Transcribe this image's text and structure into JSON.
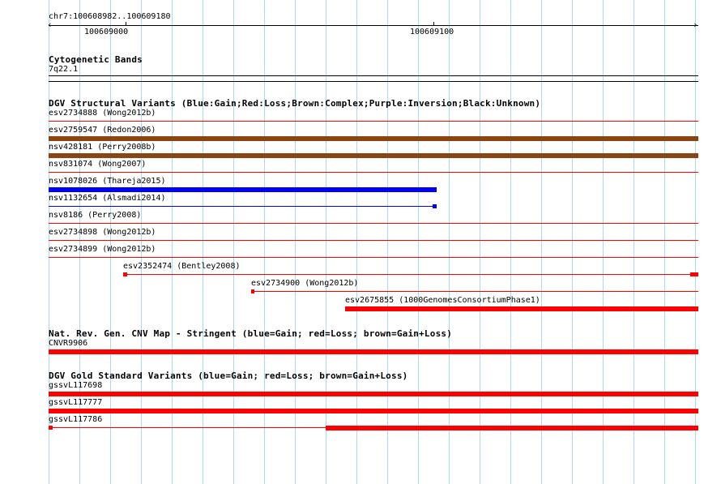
{
  "ruler": {
    "position": "chr7:100608982..100609180",
    "ticks": [
      "100609000",
      "100609100"
    ]
  },
  "cytoband": {
    "title": "Cytogenetic Bands",
    "band": "7q22.1"
  },
  "dgv": {
    "title": "DGV Structural Variants (Blue:Gain;Red:Loss;Brown:Complex;Purple:Inversion;Black:Unknown)",
    "features": [
      {
        "label": "esv2734888 (Wong2012b)",
        "color": "#ff0000",
        "style": "thin"
      },
      {
        "label": "esv2759547 (Redon2006)",
        "color": "#8b4513",
        "style": "thick"
      },
      {
        "label": "nsv428181 (Perry2008b)",
        "color": "#8b4513",
        "style": "thick"
      },
      {
        "label": "nsv831074 (Wong2007)",
        "color": "#ff0000",
        "style": "thin"
      },
      {
        "label": "nsv1078026 (Thareja2015)",
        "color": "#0000ff",
        "style": "thick"
      },
      {
        "label": "nsv1132654 (Alsmadi2014)",
        "color": "#0000ff",
        "style": "thin-cap"
      },
      {
        "label": "nsv8186 (Perry2008)",
        "color": "#ff0000",
        "style": "thin"
      },
      {
        "label": "esv2734898 (Wong2012b)",
        "color": "#ff0000",
        "style": "thin"
      },
      {
        "label": "esv2734899 (Wong2012b)",
        "color": "#ff0000",
        "style": "thin"
      },
      {
        "label": "esv2352474 (Bentley2008)",
        "color": "#ff0000",
        "style": "thin-cap"
      },
      {
        "label": "esv2734900 (Wong2012b)",
        "color": "#ff0000",
        "style": "thin-cap"
      },
      {
        "label": "esv2675855 (1000GenomesConsortiumPhase1)",
        "color": "#ff0000",
        "style": "thick"
      }
    ]
  },
  "cnvmap": {
    "title": "Nat. Rev. Gen. CNV Map - Stringent (blue=Gain; red=Loss; brown=Gain+Loss)",
    "features": [
      {
        "label": "CNVR9906",
        "color": "#ff0000",
        "style": "thick"
      }
    ]
  },
  "gold": {
    "title": "DGV Gold Standard Variants (blue=Gain; red=Loss; brown=Gain+Loss)",
    "features": [
      {
        "label": "gssvL117698",
        "color": "#ff0000",
        "style": "thick"
      },
      {
        "label": "gssvL117777",
        "color": "#ff0000",
        "style": "thick"
      },
      {
        "label": "gssvL117786",
        "color": "#ff0000",
        "style": "split"
      }
    ]
  }
}
